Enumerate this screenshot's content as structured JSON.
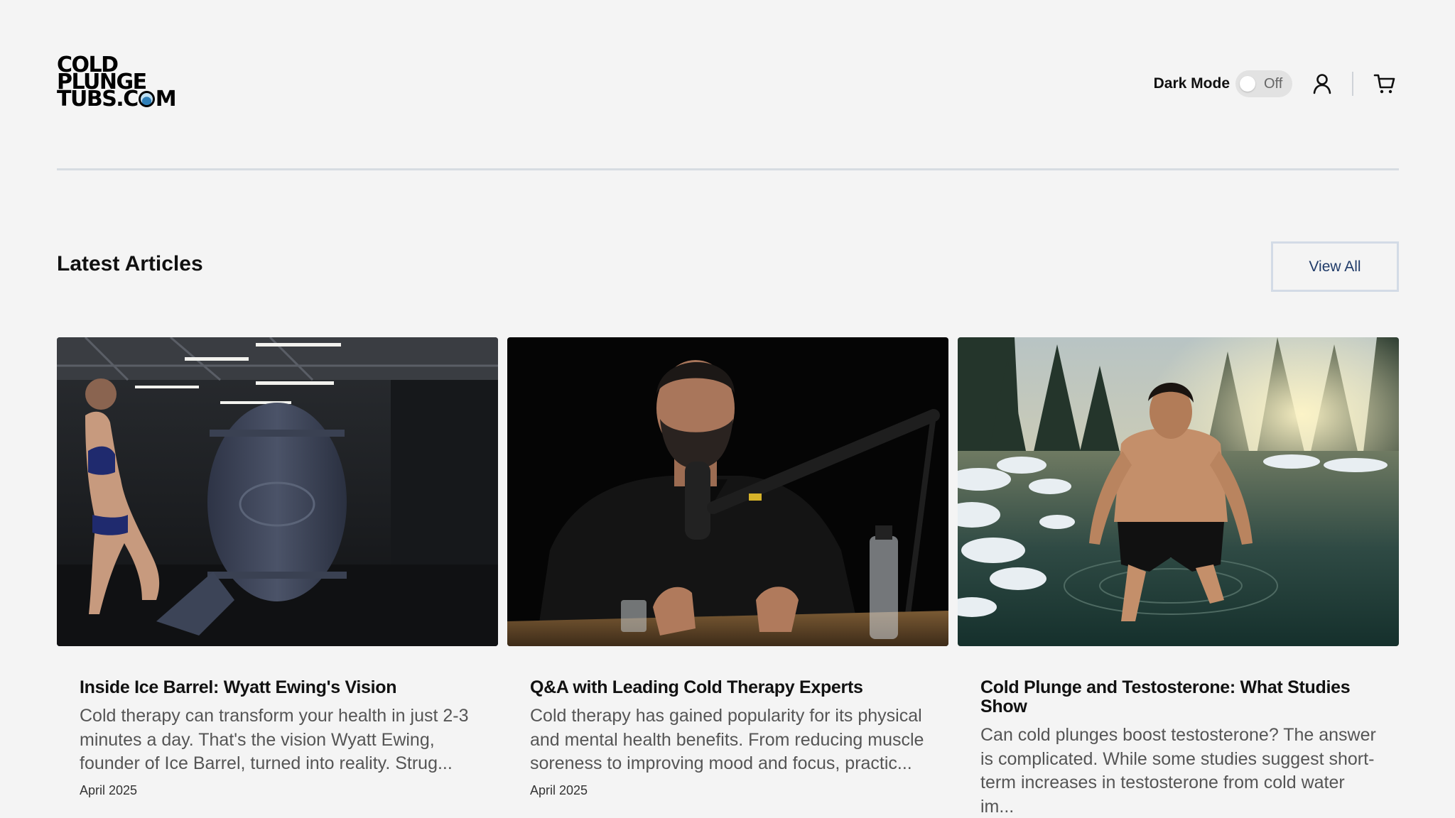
{
  "header": {
    "logo_lines": [
      "COLD",
      "PLUNGE",
      "TUBS.C",
      "M"
    ],
    "dark_mode_label": "Dark Mode",
    "toggle_state": "Off"
  },
  "section": {
    "title": "Latest Articles",
    "view_all": "View All"
  },
  "articles": [
    {
      "title": "Inside Ice Barrel: Wyatt Ewing's Vision",
      "excerpt": "Cold therapy can transform your health in just 2-3 minutes a day. That's the vision Wyatt Ewing, founder of Ice Barrel, turned into reality. Strug...",
      "date": "April 2025"
    },
    {
      "title": "Q&A with Leading Cold Therapy Experts",
      "excerpt": "Cold therapy has gained popularity for its physical and mental health benefits. From reducing muscle soreness to improving mood and focus, practic...",
      "date": "April 2025"
    },
    {
      "title": "Cold Plunge and Testosterone: What Studies Show",
      "excerpt": "Can cold plunges boost testosterone? The answer is complicated. While some studies suggest short-term increases in testosterone from cold water im...",
      "date": ""
    }
  ]
}
